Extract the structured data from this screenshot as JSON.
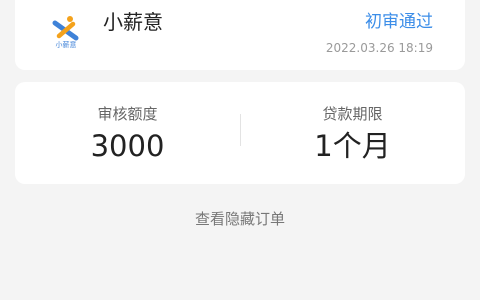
{
  "order": {
    "app_name": "小薪意",
    "logo_text": "小薪意",
    "logo_icon": "runner-logo-icon",
    "status": "初审通过",
    "time": "2022.03.26 18:19",
    "colors": {
      "status": "#3b8de8",
      "logo_blue": "#3f82d8",
      "logo_orange": "#f4a21c"
    }
  },
  "details": {
    "amount_label": "审核额度",
    "amount_value": "3000",
    "term_label": "贷款期限",
    "term_value": "1个月"
  },
  "footer": {
    "hidden_orders_label": "查看隐藏订单"
  }
}
